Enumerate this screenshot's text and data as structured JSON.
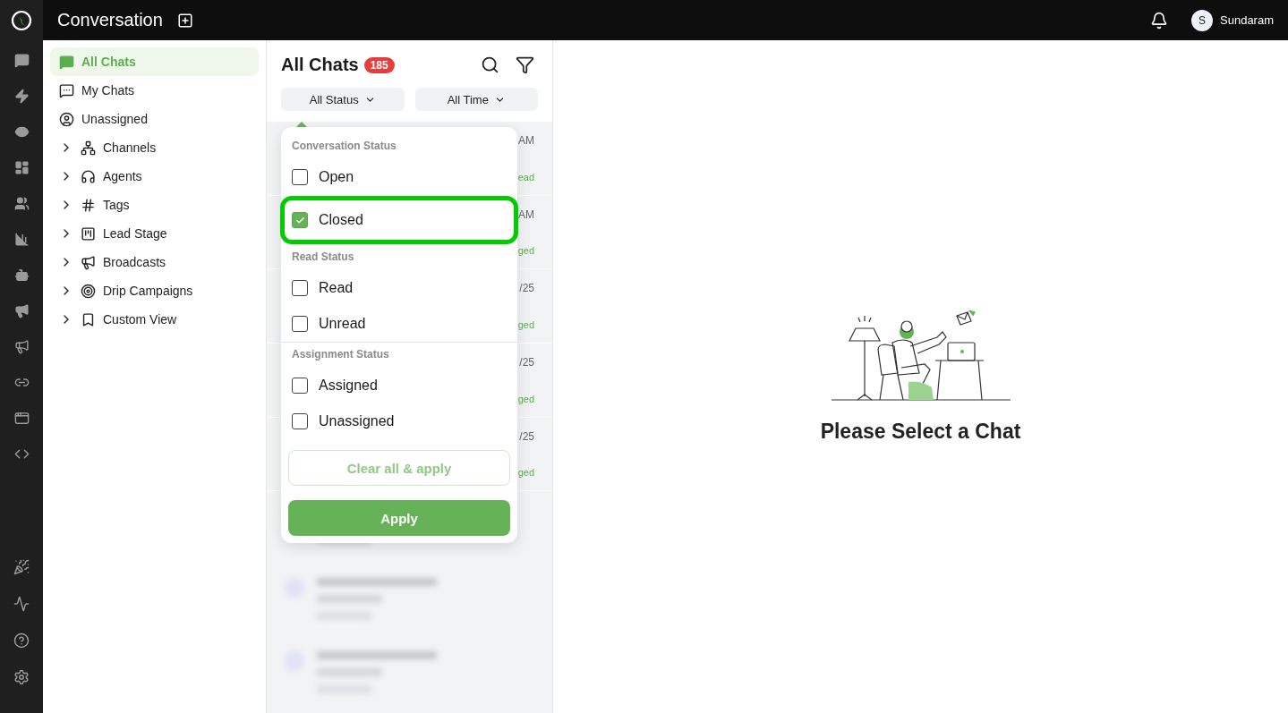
{
  "app": {
    "title": "Conversation"
  },
  "user": {
    "initial": "S",
    "name": "Sundaram"
  },
  "sidebar": {
    "items": [
      {
        "label": "All Chats",
        "selected": true,
        "expandable": false
      },
      {
        "label": "My Chats",
        "selected": false,
        "expandable": false
      },
      {
        "label": "Unassigned",
        "selected": false,
        "expandable": false
      },
      {
        "label": "Channels",
        "selected": false,
        "expandable": true
      },
      {
        "label": "Agents",
        "selected": false,
        "expandable": true
      },
      {
        "label": "Tags",
        "selected": false,
        "expandable": true
      },
      {
        "label": "Lead Stage",
        "selected": false,
        "expandable": true
      },
      {
        "label": "Broadcasts",
        "selected": false,
        "expandable": true
      },
      {
        "label": "Drip Campaigns",
        "selected": false,
        "expandable": true
      },
      {
        "label": "Custom View",
        "selected": false,
        "expandable": true
      }
    ]
  },
  "chat_list": {
    "title": "All Chats",
    "count": "185",
    "filters": [
      {
        "label": "All Status"
      },
      {
        "label": "All Time"
      }
    ],
    "rows": [
      {
        "time": "AM",
        "status": "ead"
      },
      {
        "time": "AM",
        "status": "ged"
      },
      {
        "time": "/25",
        "status": "ged"
      },
      {
        "time": "/25",
        "status": "ged"
      },
      {
        "time": "/25",
        "status": "ged"
      }
    ]
  },
  "status_menu": {
    "groups": [
      {
        "title": "Conversation Status",
        "options": [
          {
            "label": "Open",
            "checked": false,
            "highlighted": false
          },
          {
            "label": "Closed",
            "checked": true,
            "highlighted": true
          }
        ]
      },
      {
        "title": "Read Status",
        "options": [
          {
            "label": "Read",
            "checked": false,
            "highlighted": false
          },
          {
            "label": "Unread",
            "checked": false,
            "highlighted": false
          }
        ]
      },
      {
        "title": "Assignment Status",
        "options": [
          {
            "label": "Assigned",
            "checked": false,
            "highlighted": false
          },
          {
            "label": "Unassigned",
            "checked": false,
            "highlighted": false
          }
        ]
      }
    ],
    "clear_button": {
      "label": "Clear all & apply",
      "disabled": true
    },
    "apply_button": {
      "label": "Apply"
    }
  },
  "empty_state": {
    "message": "Please Select a Chat"
  }
}
